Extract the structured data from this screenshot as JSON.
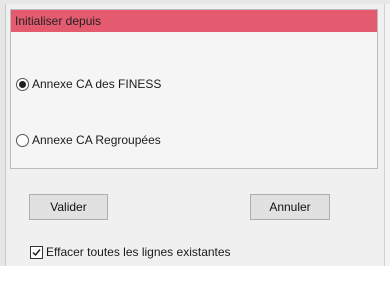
{
  "dialog": {
    "title": "Initialiser depuis",
    "title_bar_color": "#e45a6e"
  },
  "options": [
    {
      "label": "Annexe CA des FINESS",
      "checked": true
    },
    {
      "label": "Annexe CA Regroupées",
      "checked": false
    }
  ],
  "buttons": {
    "validate_label": "Valider",
    "cancel_label": "Annuler"
  },
  "checkbox": {
    "label": "Effacer toutes les lignes existantes",
    "checked": true
  },
  "icons": {
    "checkbox_mark": "check-icon"
  }
}
